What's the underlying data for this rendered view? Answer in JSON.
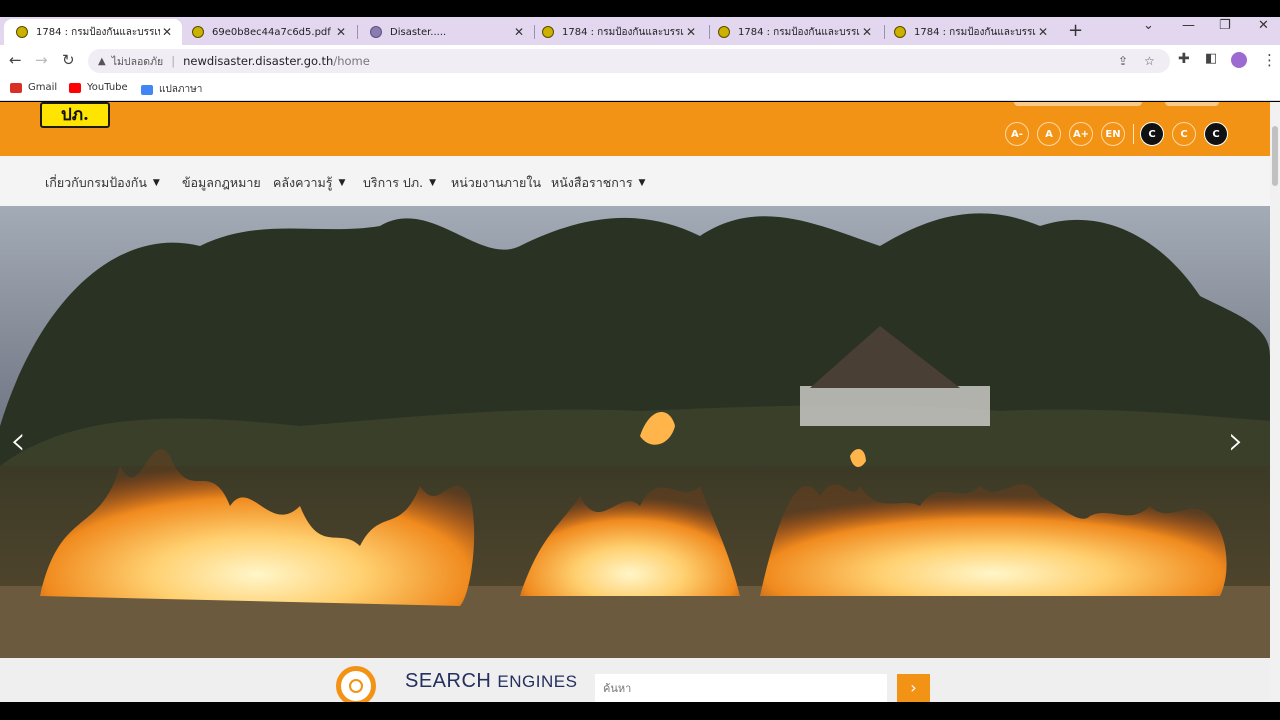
{
  "browser": {
    "tabs": [
      {
        "title": "1784 : กรมป้องกันและบรรเทาสา",
        "active": true
      },
      {
        "title": "69e0b8ec44a7c6d5.pdf"
      },
      {
        "title": "Disaster....."
      },
      {
        "title": "1784 : กรมป้องกันและบรรเทาสา"
      },
      {
        "title": "1784 : กรมป้องกันและบรรเทาสา"
      },
      {
        "title": "1784 : กรมป้องกันและบรรเทาสา"
      }
    ],
    "new_tab": "+",
    "security_label": "ไม่ปลอดภัย",
    "url_host": "newdisaster.disaster.go.th",
    "url_path": "/home",
    "bookmarks": [
      {
        "label": "Gmail",
        "icon": "gmail-icon",
        "color": "#d93025"
      },
      {
        "label": "YouTube",
        "icon": "youtube-icon",
        "color": "#ff0000"
      },
      {
        "label": "แปลภาษา",
        "icon": "translate-icon",
        "color": "#4285f4"
      }
    ]
  },
  "site": {
    "logo_text": "ปภ.",
    "brand_color": "#f39315",
    "accessibility_buttons": [
      "A-",
      "A",
      "A+",
      "EN",
      "C",
      "C",
      "C"
    ],
    "nav": [
      {
        "label": "เกี่ยวกับกรมป้องกัน",
        "has_dropdown": true
      },
      {
        "label": "ข้อมูลกฎหมาย",
        "has_dropdown": false
      },
      {
        "label": "คลังความรู้",
        "has_dropdown": true
      },
      {
        "label": "บริการ ปภ.",
        "has_dropdown": true
      },
      {
        "label": "หน่วยงานภายใน",
        "has_dropdown": false
      },
      {
        "label": "หนังสือราชการ",
        "has_dropdown": true
      }
    ],
    "hero": {
      "prev": "‹",
      "next": "›",
      "image": "wildfire-field-banner"
    },
    "search": {
      "title_big": "SEARCH",
      "title_small": "ENGINES",
      "placeholder": "ค้นหา",
      "go": "›"
    }
  }
}
